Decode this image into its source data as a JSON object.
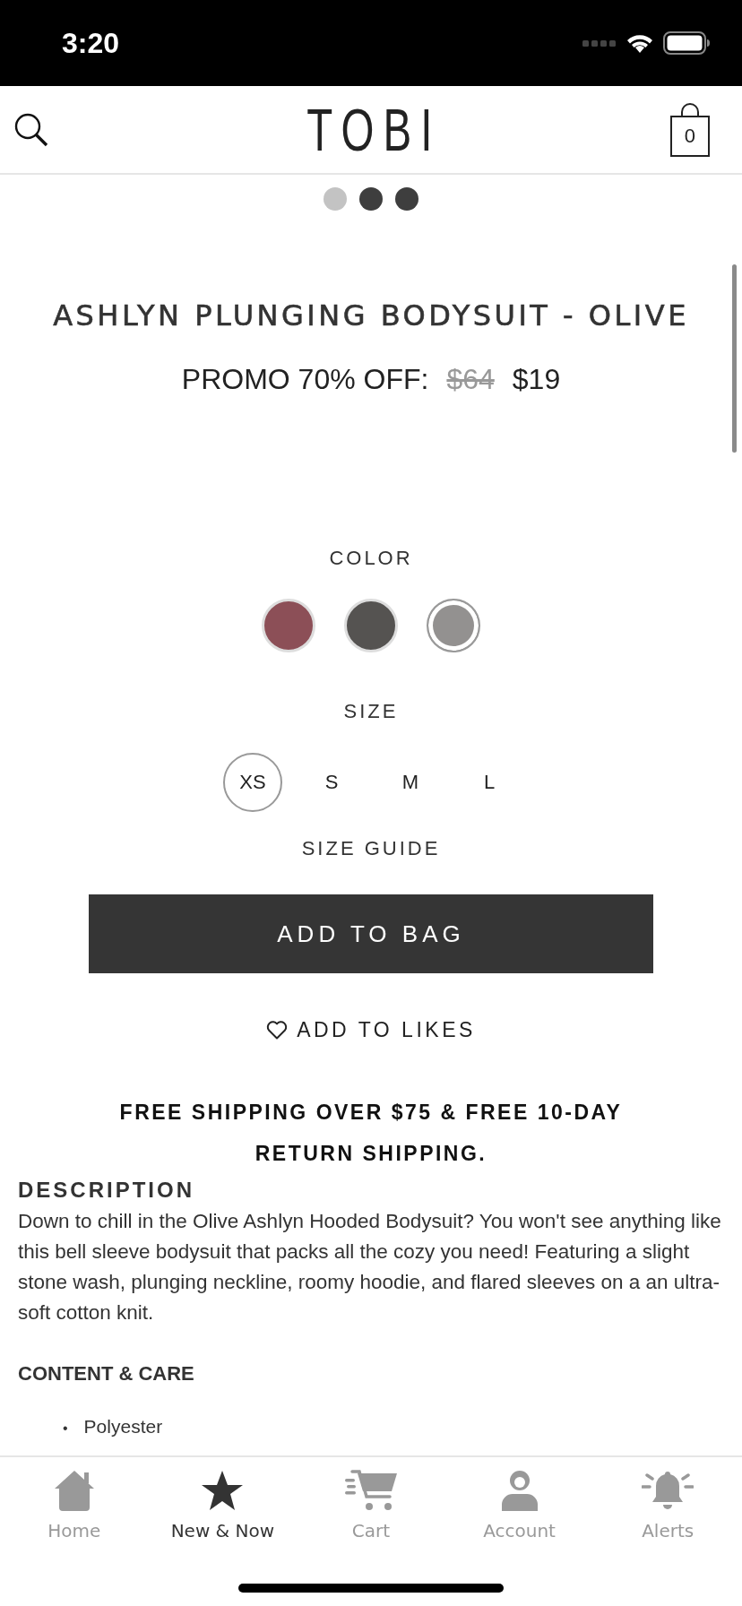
{
  "status_bar": {
    "time": "3:20"
  },
  "header": {
    "logo": "TOBI",
    "bag_count": "0"
  },
  "gallery_dots": [
    {
      "selected": false
    },
    {
      "selected": true
    },
    {
      "selected": true
    }
  ],
  "product": {
    "title": "ASHLYN PLUNGING BODYSUIT - OLIVE",
    "promo_label": "PROMO 70% OFF:",
    "old_price": "$64",
    "price": "$19"
  },
  "color_label": "COLOR",
  "colors": [
    {
      "color": "#8c4f57",
      "selected": false
    },
    {
      "color": "#555351",
      "selected": false
    },
    {
      "color": "#939190",
      "selected": true
    }
  ],
  "size_label": "SIZE",
  "sizes": [
    {
      "label": "XS",
      "selected": true
    },
    {
      "label": "S",
      "selected": false
    },
    {
      "label": "M",
      "selected": false
    },
    {
      "label": "L",
      "selected": false
    }
  ],
  "size_guide": "SIZE GUIDE",
  "add_to_bag": "ADD TO BAG",
  "add_to_likes": "ADD TO LIKES",
  "shipping_note": "FREE SHIPPING OVER $75 & FREE 10-DAY RETURN SHIPPING.",
  "description": {
    "heading": "DESCRIPTION",
    "text": "Down to chill in the Olive Ashlyn Hooded Bodysuit? You won't see anything like this bell sleeve bodysuit that packs all the cozy you need! Featuring a slight stone wash, plunging neckline, roomy hoodie, and flared sleeves on a an ultra-soft cotton knit."
  },
  "content_care": {
    "heading": "CONTENT & CARE",
    "items": [
      {
        "bullet": "•",
        "text": "Polyester"
      }
    ]
  },
  "tab_bar": [
    {
      "label": "Home",
      "kind": "home",
      "selected": false
    },
    {
      "label": "New & Now",
      "kind": "star",
      "selected": true
    },
    {
      "label": "Cart",
      "kind": "cart",
      "selected": false
    },
    {
      "label": "Account",
      "kind": "account",
      "selected": false
    },
    {
      "label": "Alerts",
      "kind": "alerts",
      "selected": false
    }
  ]
}
